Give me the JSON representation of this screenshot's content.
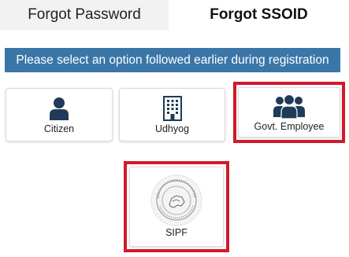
{
  "tabs": {
    "forgot_password": "Forgot Password",
    "forgot_ssoid": "Forgot SSOID"
  },
  "banner": "Please select an option followed earlier during registration",
  "options": {
    "citizen": {
      "label": "Citizen",
      "icon": "user-icon"
    },
    "udhyog": {
      "label": "Udhyog",
      "icon": "building-icon"
    },
    "govt": {
      "label": "Govt. Employee",
      "icon": "users-group-icon",
      "highlighted": true
    },
    "sipf": {
      "label": "SIPF",
      "icon": "sipf-seal-icon",
      "highlighted": true
    }
  },
  "colors": {
    "banner_bg": "#3a76a8",
    "highlight_border": "#d11a2a",
    "icon_color": "#1f3b57"
  }
}
